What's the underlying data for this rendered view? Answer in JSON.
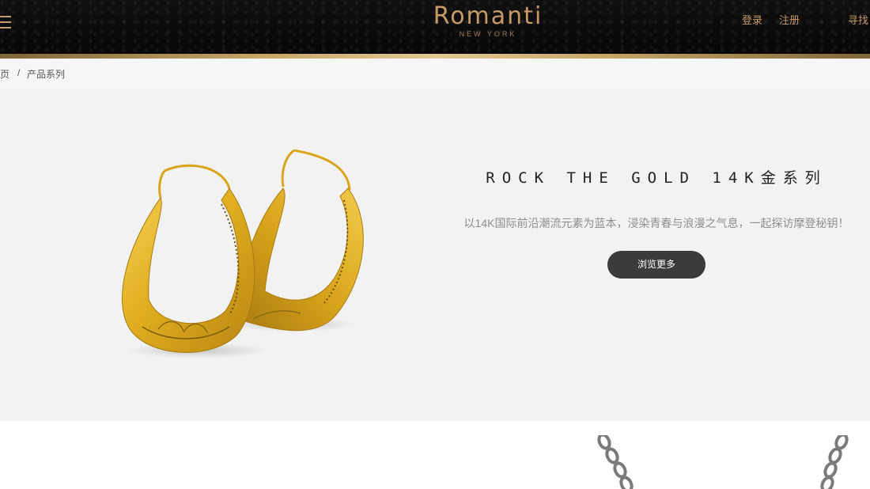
{
  "header": {
    "logo_main": "Romanti",
    "logo_sub": "NEW YORK",
    "nav": {
      "login": "登录",
      "register": "注册",
      "find": "寻找"
    }
  },
  "breadcrumb": {
    "home": "首页",
    "separator": "/",
    "current": "产品系列"
  },
  "hero": {
    "title": "ROCK THE GOLD 14K金系列",
    "description": "以14K国际前沿潮流元素为蓝本，浸染青春与浪漫之气息，一起探访摩登秘钥！",
    "button_label": "浏览更多"
  },
  "colors": {
    "header_bg": "#0b0b0b",
    "accent_gold": "#c89a67",
    "hero_bg": "#f2f2f2",
    "button_bg": "#3b3b3b"
  },
  "icons": [
    "menu-icon",
    "gold-hoop-earrings-image",
    "silver-chain-image"
  ]
}
